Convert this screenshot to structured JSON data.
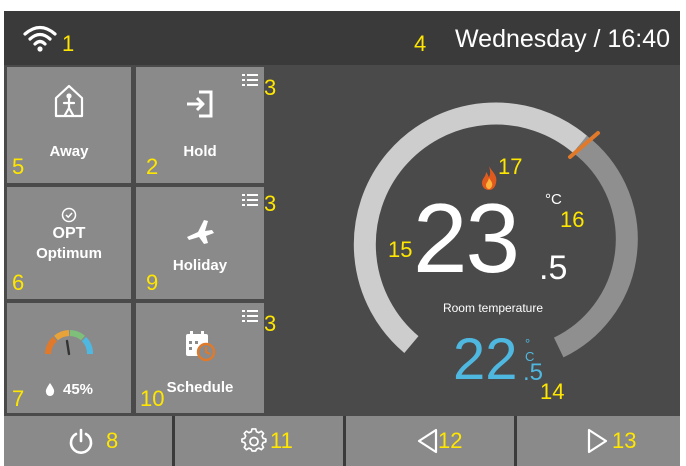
{
  "status_bar": {
    "datetime": "Wednesday / 16:40",
    "wifi_icon": "wifi-icon"
  },
  "tiles": {
    "away": {
      "label": "Away",
      "icon": "home-away-icon"
    },
    "hold": {
      "label": "Hold",
      "icon": "login-arrow-icon"
    },
    "optimum": {
      "label_top": "OPT",
      "label": "Optimum",
      "icon": "check-circle-icon"
    },
    "holiday": {
      "label": "Holiday",
      "icon": "airplane-icon"
    },
    "humidity": {
      "value": "45%",
      "icon": "gauge-icon",
      "drop_icon": "water-drop-icon"
    },
    "schedule": {
      "label": "Schedule",
      "icon": "calendar-clock-icon"
    }
  },
  "display": {
    "room_temp_int": "23",
    "room_temp_dec": ".5",
    "room_temp_unit": "°C",
    "room_temp_caption": "Room temperature",
    "set_temp_int": "22",
    "set_temp_dec": ".5",
    "set_temp_unit": "°C",
    "heating_icon": "flame-icon"
  },
  "bottom_bar": {
    "power_icon": "power-icon",
    "settings_icon": "gear-icon",
    "prev_icon": "triangle-left-icon",
    "next_icon": "triangle-right-icon"
  },
  "callouts": {
    "wifi": "1",
    "hold": "2",
    "menu_hold": "3",
    "menu_holiday": "3",
    "menu_schedule": "3",
    "datetime": "4",
    "away": "5",
    "optimum": "6",
    "humidity": "7",
    "power": "8",
    "holiday": "9",
    "schedule": "10",
    "settings": "11",
    "prev": "12",
    "next": "13",
    "set_temp": "14",
    "room_temp": "15",
    "unit": "16",
    "heating": "17"
  },
  "colors": {
    "accent_blue": "#4fb8e0",
    "callout_yellow": "#ffe600",
    "marker_orange": "#e07a2a",
    "tile_gray": "#8a8a8a"
  }
}
